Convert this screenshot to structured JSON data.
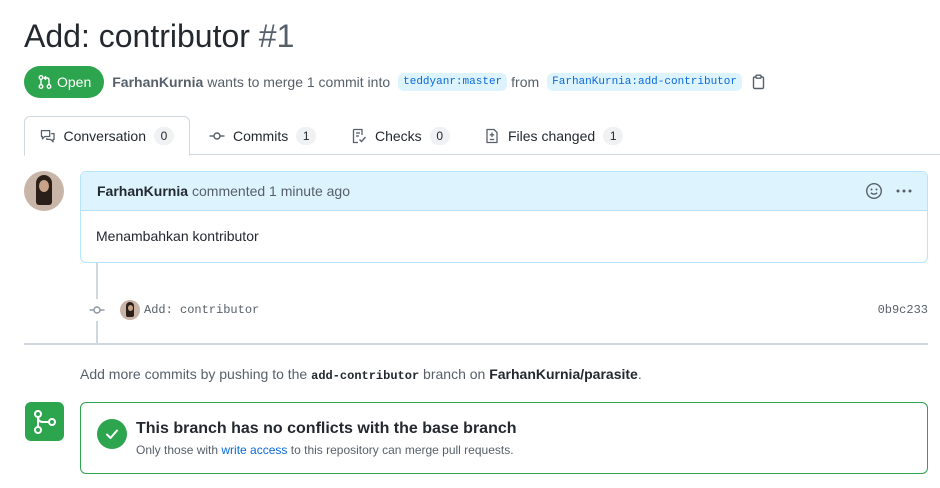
{
  "pr": {
    "title": "Add: contributor",
    "number": "#1",
    "state_label": "Open",
    "author": "FarhanKurnia",
    "merge_text": "wants to merge 1 commit into",
    "base_branch": "teddyanr:master",
    "from_text": "from",
    "head_branch": "FarhanKurnia:add-contributor"
  },
  "tabs": [
    {
      "label": "Conversation",
      "count": "0",
      "icon": "comment-discussion-icon"
    },
    {
      "label": "Commits",
      "count": "1",
      "icon": "git-commit-icon"
    },
    {
      "label": "Checks",
      "count": "0",
      "icon": "checklist-icon"
    },
    {
      "label": "Files changed",
      "count": "1",
      "icon": "file-diff-icon"
    }
  ],
  "comment": {
    "author": "FarhanKurnia",
    "meta": "commented 1 minute ago",
    "body": "Menambahkan kontributor"
  },
  "commit": {
    "message": "Add: contributor",
    "sha": "0b9c233"
  },
  "push_note": {
    "prefix": "Add more commits by pushing to the",
    "branch": "add-contributor",
    "middle": "branch on",
    "repo": "FarhanKurnia/parasite",
    "suffix": "."
  },
  "merge": {
    "title": "This branch has no conflicts with the base branch",
    "sub_prefix": "Only those with",
    "sub_link": "write access",
    "sub_suffix": "to this repository can merge pull requests."
  },
  "colors": {
    "open_green": "#2da44e",
    "link_blue": "#0969da",
    "comment_header_bg": "#ddf4ff",
    "comment_border": "#b6e3ff"
  }
}
